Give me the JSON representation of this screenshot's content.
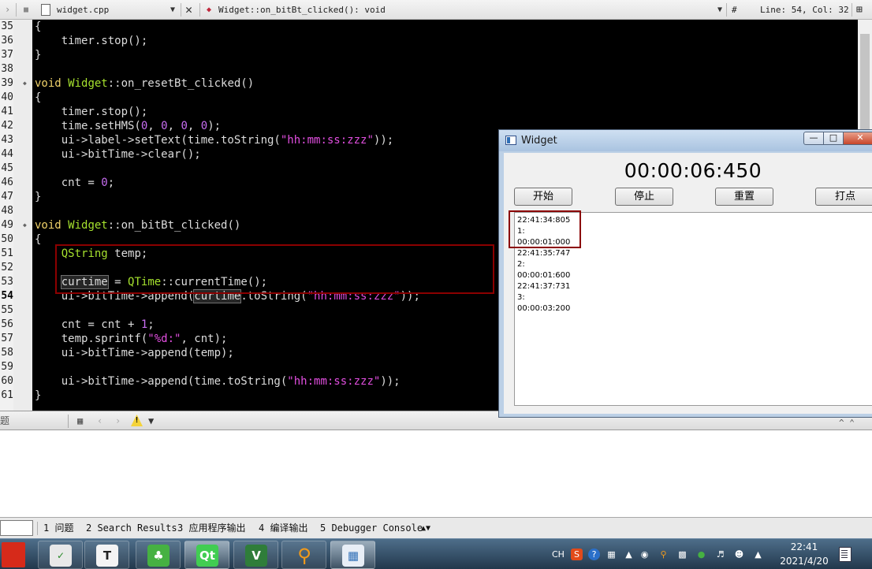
{
  "editor": {
    "file_name": "widget.cpp",
    "function": "Widget::on_bitBt_clicked(): void",
    "hash": "#",
    "cursor": "Line: 54, Col: 32",
    "current_line": 54,
    "line_numbers": [
      "35",
      "36",
      "37",
      "38",
      "39",
      "40",
      "41",
      "42",
      "43",
      "44",
      "45",
      "46",
      "47",
      "48",
      "49",
      "50",
      "51",
      "52",
      "53",
      "54",
      "55",
      "56",
      "57",
      "58",
      "59",
      "60",
      "61"
    ],
    "fold_lines": [
      39,
      49
    ]
  },
  "code_lines": [
    [
      {
        "t": "{",
        "c": "fn"
      }
    ],
    [
      {
        "t": "    timer.stop();",
        "c": "fn"
      }
    ],
    [
      {
        "t": "}",
        "c": "fn"
      }
    ],
    [],
    [
      {
        "t": "void ",
        "c": "kw"
      },
      {
        "t": "Widget",
        "c": "cls"
      },
      {
        "t": "::on_resetBt_clicked()",
        "c": "fn"
      }
    ],
    [
      {
        "t": "{",
        "c": "fn"
      }
    ],
    [
      {
        "t": "    timer.stop();",
        "c": "fn"
      }
    ],
    [
      {
        "t": "    time.setHMS(",
        "c": "fn"
      },
      {
        "t": "0",
        "c": "num"
      },
      {
        "t": ", ",
        "c": "fn"
      },
      {
        "t": "0",
        "c": "num"
      },
      {
        "t": ", ",
        "c": "fn"
      },
      {
        "t": "0",
        "c": "num"
      },
      {
        "t": ", ",
        "c": "fn"
      },
      {
        "t": "0",
        "c": "num"
      },
      {
        "t": ");",
        "c": "fn"
      }
    ],
    [
      {
        "t": "    ui->label->setText(time.toString(",
        "c": "fn"
      },
      {
        "t": "\"hh:mm:ss:zzz\"",
        "c": "str"
      },
      {
        "t": "));",
        "c": "fn"
      }
    ],
    [
      {
        "t": "    ui->bitTime->clear();",
        "c": "fn"
      }
    ],
    [],
    [
      {
        "t": "    cnt = ",
        "c": "fn"
      },
      {
        "t": "0",
        "c": "num"
      },
      {
        "t": ";",
        "c": "fn"
      }
    ],
    [
      {
        "t": "}",
        "c": "fn"
      }
    ],
    [],
    [
      {
        "t": "void ",
        "c": "kw"
      },
      {
        "t": "Widget",
        "c": "cls"
      },
      {
        "t": "::on_bitBt_clicked()",
        "c": "fn"
      }
    ],
    [
      {
        "t": "{",
        "c": "fn"
      }
    ],
    [
      {
        "t": "    ",
        "c": "fn"
      },
      {
        "t": "QString",
        "c": "cls"
      },
      {
        "t": " temp;",
        "c": "fn"
      }
    ],
    [],
    [
      {
        "t": "    ",
        "c": "fn"
      },
      {
        "t": "curtime",
        "c": "fn boxed"
      },
      {
        "t": " = ",
        "c": "fn"
      },
      {
        "t": "QTime",
        "c": "cls"
      },
      {
        "t": "::currentTime();",
        "c": "fn"
      }
    ],
    [
      {
        "t": "    ui->bitTime->append(",
        "c": "fn"
      },
      {
        "t": "curtime",
        "c": "fn boxed"
      },
      {
        "t": ".toString(",
        "c": "fn"
      },
      {
        "t": "\"hh:mm:ss:zzz\"",
        "c": "str"
      },
      {
        "t": "));",
        "c": "fn"
      }
    ],
    [],
    [
      {
        "t": "    cnt = cnt + ",
        "c": "fn"
      },
      {
        "t": "1",
        "c": "num"
      },
      {
        "t": ";",
        "c": "fn"
      }
    ],
    [
      {
        "t": "    temp.sprintf(",
        "c": "fn"
      },
      {
        "t": "\"%d:\"",
        "c": "str"
      },
      {
        "t": ", cnt);",
        "c": "fn"
      }
    ],
    [
      {
        "t": "    ui->bitTime->append(temp);",
        "c": "fn"
      }
    ],
    [],
    [
      {
        "t": "    ui->bitTime->append(time.toString(",
        "c": "fn"
      },
      {
        "t": "\"hh:mm:ss:zzz\"",
        "c": "str"
      },
      {
        "t": "));",
        "c": "fn"
      }
    ],
    [
      {
        "t": "}",
        "c": "fn"
      }
    ]
  ],
  "issues_bar": {
    "left_label": "题"
  },
  "output_tabs": [
    "1 问题",
    "2 Search Results",
    "3 应用程序输出",
    "4 编译输出",
    "5 Debugger Console"
  ],
  "widget": {
    "title": "Widget",
    "time_display": "00:00:06:450",
    "buttons": {
      "start": "开始",
      "stop": "停止",
      "reset": "重置",
      "mark": "打点"
    },
    "laps": [
      "22:41:34:805",
      "1:",
      "00:00:01:000",
      "22:41:35:747",
      "2:",
      "00:00:01:600",
      "22:41:37:731",
      "3:",
      "00:00:03:200"
    ]
  },
  "taskbar": {
    "lang": "CH",
    "time": "22:41",
    "date": "2021/4/20"
  },
  "colors": {
    "highlight_box": "#8b0000",
    "keyword": "#f0d26a",
    "class": "#a6e22e",
    "number": "#c86ef2",
    "string": "#e24fe0"
  }
}
